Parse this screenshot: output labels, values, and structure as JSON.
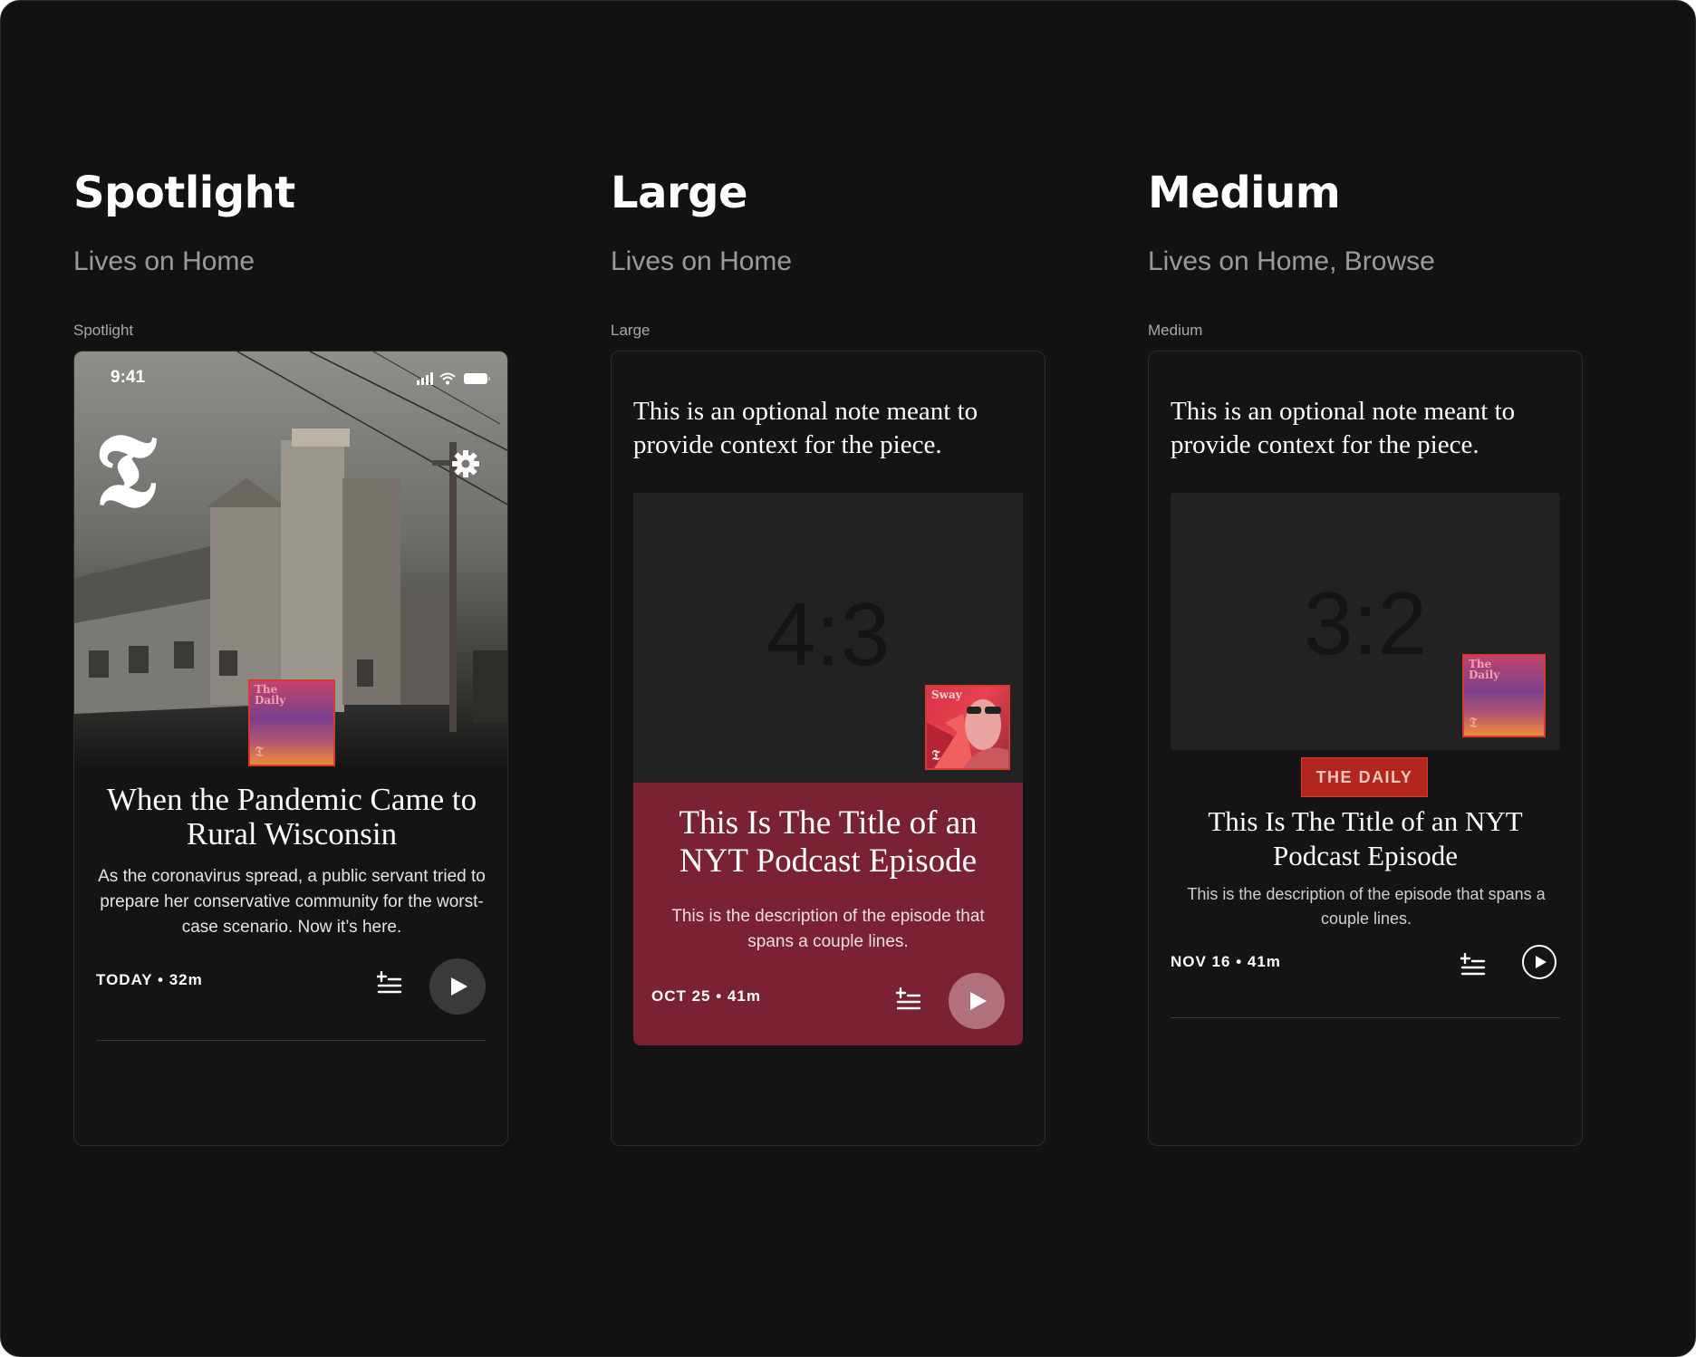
{
  "columns": [
    {
      "title": "Spotlight",
      "subtitle": "Lives on Home",
      "frame_label": "Spotlight"
    },
    {
      "title": "Large",
      "subtitle": "Lives on Home",
      "frame_label": "Large"
    },
    {
      "title": "Medium",
      "subtitle": "Lives on Home, Browse",
      "frame_label": "Medium"
    }
  ],
  "spotlight": {
    "status_time": "9:41",
    "logo": "𝕿",
    "art_title": "The\nDaily",
    "art_mark": "𝕿",
    "title": "When the Pandemic Came to Rural Wisconsin",
    "description": "As the coronavirus spread, a public servant tried to prepare her conservative community for the worst-case scenario. Now it’s here.",
    "meta": "TODAY • 32m"
  },
  "large": {
    "note": "This is an optional note meant to provide context for the piece.",
    "ratio": "4:3",
    "art_title": "Sway",
    "art_mark": "𝕿",
    "title": "This Is The Title of an NYT Podcast Episode",
    "description": "This is the description of the episode that spans a couple lines.",
    "meta": "OCT 25 • 41m"
  },
  "medium": {
    "note": "This is an optional note meant to provide context for the piece.",
    "ratio": "3:2",
    "art_title": "The\nDaily",
    "art_mark": "𝕿",
    "show_label": "THE DAILY",
    "title": "This Is The Title of an NYT Podcast Episode",
    "description": "This is the description of the episode that spans a couple lines.",
    "meta": "NOV 16 • 41m"
  },
  "colors": {
    "background": "#121212",
    "large_card": "#7a2134",
    "show_badge": "#b1261e",
    "placeholder": "#222222"
  }
}
